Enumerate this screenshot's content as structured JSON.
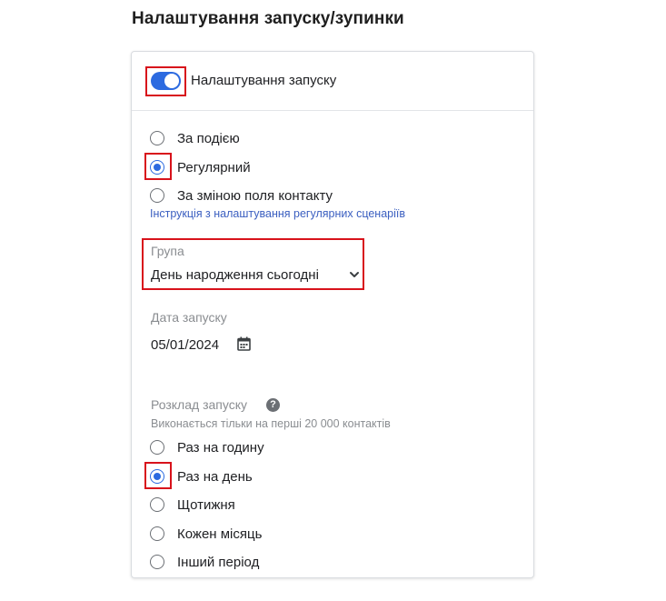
{
  "section": {
    "title": "Налаштування запуску/зупинки"
  },
  "launch_settings": {
    "toggle_label": "Налаштування запуску",
    "toggle_on": true,
    "trigger_options": [
      {
        "label": "За подією",
        "checked": false
      },
      {
        "label": "Регулярний",
        "checked": true
      },
      {
        "label": "За зміною поля контакту",
        "checked": false
      }
    ],
    "help_link": "Інструкція з налаштування регулярних сценаріїв",
    "group": {
      "label": "Група",
      "value": "День народження сьогодні"
    },
    "launch_date": {
      "label": "Дата запуску",
      "value": "05/01/2024"
    },
    "schedule": {
      "label": "Розклад запуску",
      "note": "Виконається тільки на перші 20 000 контактів",
      "options": [
        {
          "label": "Раз на годину",
          "checked": false
        },
        {
          "label": "Раз на день",
          "checked": true
        },
        {
          "label": "Щотижня",
          "checked": false
        },
        {
          "label": "Кожен місяць",
          "checked": false
        },
        {
          "label": "Інший період",
          "checked": false
        }
      ]
    }
  },
  "colors": {
    "accent": "#2c6ae0",
    "highlight": "#d8121b",
    "link": "#3b5fc0",
    "muted": "#8a8d91"
  },
  "icons": {
    "calendar": "calendar-icon",
    "help": "question-circle-icon",
    "dropdown": "chevron-down-icon"
  }
}
